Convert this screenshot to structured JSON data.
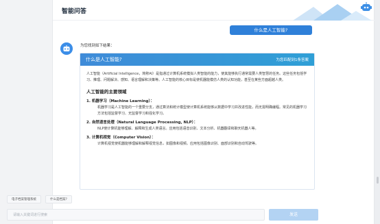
{
  "header": {
    "title": "智能问答"
  },
  "conversation": {
    "user_question": "什么是人工智能?",
    "bot_intro": "为您找到如下结果：",
    "card": {
      "title": "什么是人工智能?",
      "match_count": "为您匹配到1条答案",
      "intro_paragraph": "人工智能（Artificial Intelligence，简称AI）是指通过计算机系统模拟人类智能的能力，使其能够执行通常需要人类智慧的任务。这些任务包括学习、推理、问题解决、感知、语言理解和决策等。人工智能的核心目标是使机器能模仿人类的认知功能，甚至在某些方面超越人类。",
      "section_title": "人工智能的主要领域",
      "items": [
        {
          "title": "1. 机器学习（Machine Learning）：",
          "desc": "机器学习是人工智能的一个重要分支，通过算法和统计模型使计算机系统能够从数据中学习并改进性能，而无需明确编程。常见的机器学习方法包括监督学习、无监督学习和强化学习。"
        },
        {
          "title": "2. 自然语言处理（Natural Language Processing, NLP）：",
          "desc": "NLP使计算机能够理解、解释和生成人类语言。应用包括语音识别、文本分析、机器翻译和聊天机器人等。"
        },
        {
          "title": "3. 计算机视觉（Computer Vision）：",
          "desc": "计算机视觉使机器能够理解和解释视觉信息，如图像和视频。应用包括图像识别、面部识别和自动驾驶等。"
        }
      ]
    }
  },
  "quick_questions": [
    "电子档案管理系统",
    "什么是档案?"
  ],
  "input": {
    "placeholder": "请输入关键词进行搜索"
  },
  "send_label": "发送",
  "colors": {
    "accent": "#2f80d9",
    "card_header": "#3f8bd8",
    "send_disabled": "#b3d3f3"
  }
}
